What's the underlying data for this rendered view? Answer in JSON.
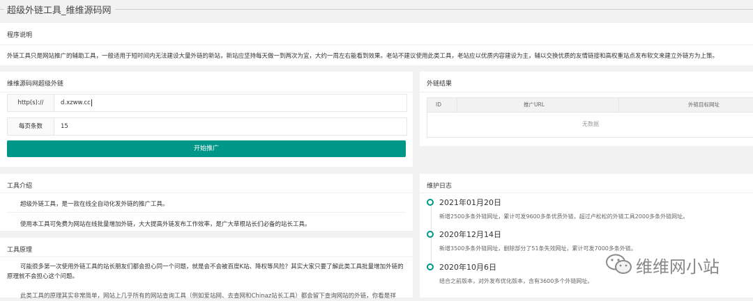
{
  "page_title": "超级外链工具_维维源码网",
  "description": {
    "heading": "程序说明",
    "text": "外链工具只是网站推广的辅助工具，一般适用于短时间内无法建设大量外链的新站，新站应坚持每天做一到两次为宜，大约一周左右能看到效果。老站不建议使用此类工具，老站应以优质内容建设为主，辅以交换优质的友情链接和高权重站点发布软文来建立外链方为上策。"
  },
  "tool": {
    "heading": "维维源码网超级外链",
    "url_label": "http(s)://",
    "url_value": "d.xzww.cc",
    "count_label": "每页条数",
    "count_value": "15",
    "start_button": "开始推广"
  },
  "result": {
    "heading": "外链结果",
    "columns": [
      "ID",
      "推广URL",
      "外链目标网址"
    ],
    "empty_text": "无数据"
  },
  "intro": {
    "heading": "工具介绍",
    "line1": "超级外链工具，是一款在线全自动化发外链的推广工具。",
    "line2": "使用本工具可免费为网站在线批量增加外链，大大提高外链发布工作效率，是广大草根站长们必备的站长工具。"
  },
  "principle": {
    "heading": "工具原理",
    "para1": "可能很多第一次使用外链工具的站长朋友们都会担心同一个问题，就是会不会被百度K站、降权等风险？其实大家只要了解此类工具批量增加外链的原理就不会担心这个问题。",
    "para2": "此类工具的原理其实非常简单，网站上几乎所有的网站查询工具（例如爱站网、去查网和Chinaz站长工具）都会留下查询网站的外链，你看是祥"
  },
  "log": {
    "heading": "维护日志",
    "entries": [
      {
        "date": "2021年01月20日",
        "text": "新增2500多条外链网址，累计可发9600多条优质外链，超过卢松松的外链工具2000多条外链网址。"
      },
      {
        "date": "2020年12月14日",
        "text": "新增3500多条外链网址，删除部分了51条失效网址，累计可发7000多条外链。"
      },
      {
        "date": "2020年10月6日",
        "text": "结合之前版本，对外发布优化版本，含有3600多个外链网址。"
      }
    ]
  },
  "watermark": {
    "text": "维维网小站",
    "icon": "wechat-icon"
  },
  "colors": {
    "accent": "#009688",
    "background": "#f2f2f2",
    "panel": "#ffffff"
  }
}
